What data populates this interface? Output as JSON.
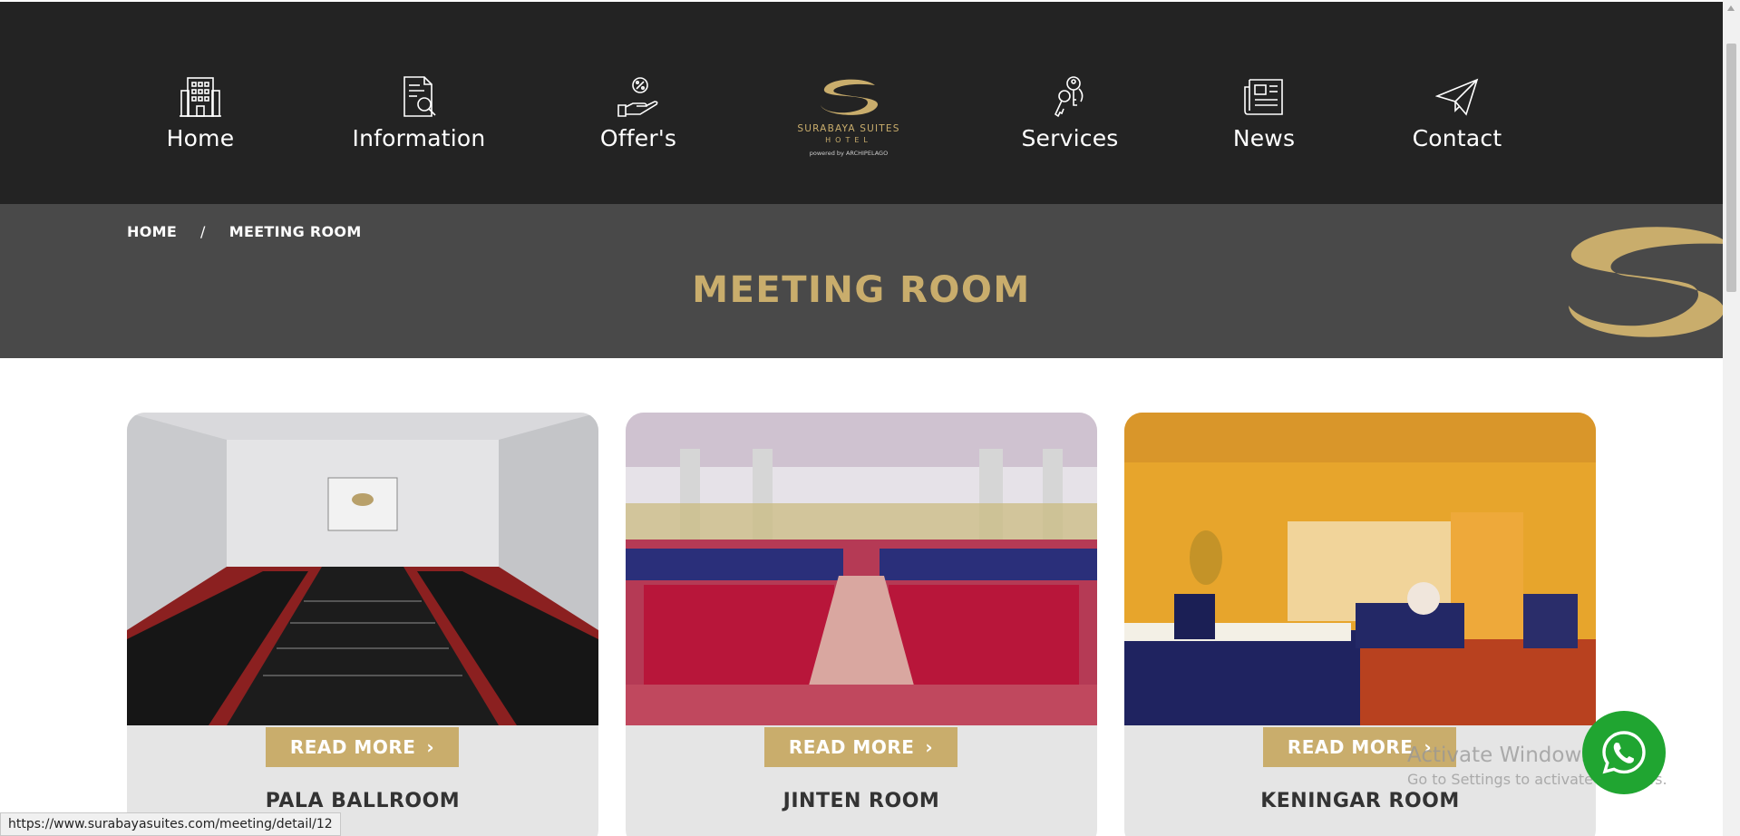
{
  "nav": {
    "items": [
      {
        "label": "Home",
        "icon": "hotel-building-icon"
      },
      {
        "label": "Information",
        "icon": "document-search-icon"
      },
      {
        "label": "Offer's",
        "icon": "hand-offer-icon"
      },
      {
        "label": "Services",
        "icon": "keys-icon"
      },
      {
        "label": "News",
        "icon": "newspaper-icon"
      },
      {
        "label": "Contact",
        "icon": "paper-plane-icon"
      }
    ],
    "logo": {
      "name": "SURABAYA SUITES",
      "sub": "HOTEL",
      "powered": "powered by ARCHIPELAGO"
    }
  },
  "breadcrumb": {
    "home": "HOME",
    "separator": "/",
    "current": "MEETING ROOM"
  },
  "page_title": "MEETING ROOM",
  "rooms": [
    {
      "name": "PALA BALLROOM",
      "button": "READ MORE"
    },
    {
      "name": "JINTEN ROOM",
      "button": "READ MORE"
    },
    {
      "name": "KENINGAR ROOM",
      "button": "READ MORE"
    }
  ],
  "status_url": "https://www.surabayasuites.com/meeting/detail/12",
  "watermark": {
    "line1": "Activate Windows",
    "line2": "Go to Settings to activate Windows."
  },
  "colors": {
    "gold": "#c9ad6c",
    "nav_bg": "#232323",
    "banner_bg": "#494949",
    "whatsapp": "#20a531"
  }
}
